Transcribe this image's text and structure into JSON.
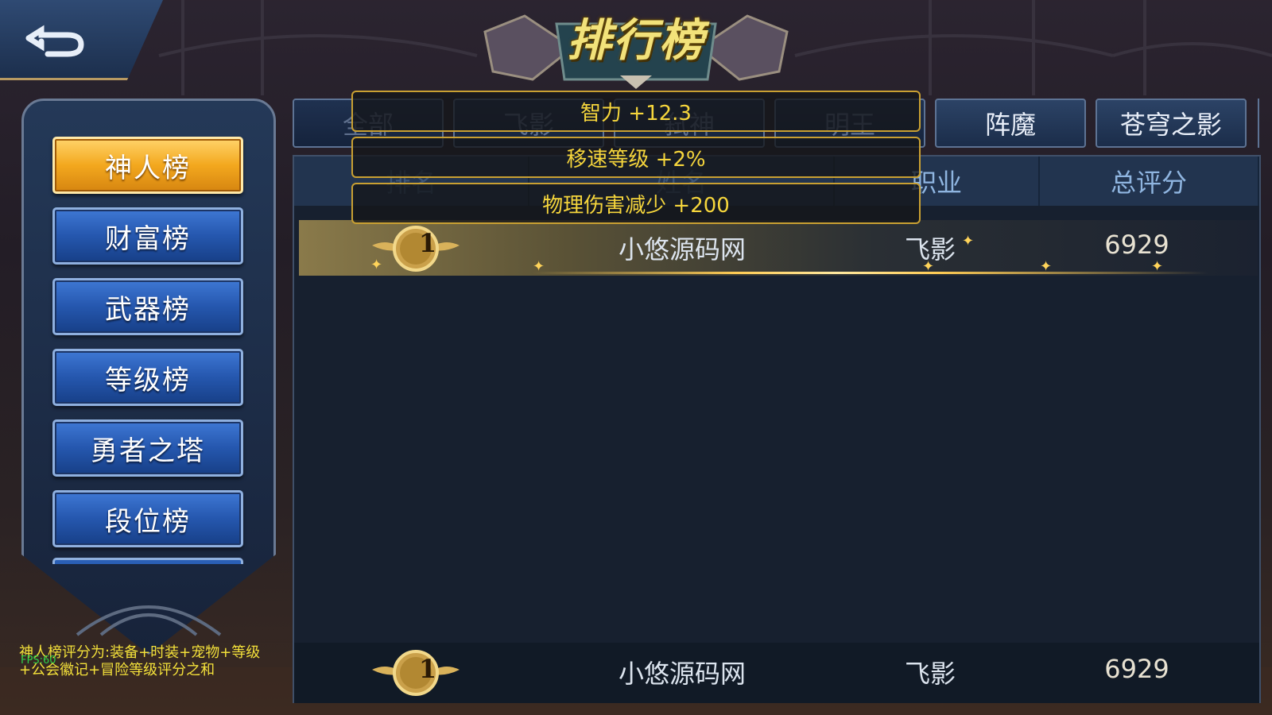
{
  "title": "排行榜",
  "back_button": {
    "icon": "back-arrow-icon"
  },
  "menu": {
    "items": [
      {
        "label": "神人榜",
        "active": true
      },
      {
        "label": "财富榜",
        "active": false
      },
      {
        "label": "武器榜",
        "active": false
      },
      {
        "label": "等级榜",
        "active": false
      },
      {
        "label": "勇者之塔",
        "active": false
      },
      {
        "label": "段位榜",
        "active": false
      }
    ]
  },
  "note": "神人榜评分为:装备+时装+宠物+等级+公会徽记+冒险等级评分之和",
  "fps": "FPS:60",
  "tabs": [
    "全部",
    "飞影",
    "弑神",
    "明王",
    "阵魔",
    "苍穹之影"
  ],
  "table": {
    "headers": [
      "排名",
      "姓名",
      "职业",
      "总评分"
    ],
    "rows": [
      {
        "rank": "1",
        "name": "小悠源码网",
        "class": "飞影",
        "score": "6929"
      }
    ],
    "self_row": {
      "rank": "1",
      "name": "小悠源码网",
      "class": "飞影",
      "score": "6929"
    }
  },
  "tooltips": [
    "智力 +12.3",
    "移速等级 +2%",
    "物理伤害减少 +200"
  ],
  "colors": {
    "gold": "#f6d63c",
    "active_tab": "#f3a81e",
    "menu_blue": "#2557ae"
  }
}
